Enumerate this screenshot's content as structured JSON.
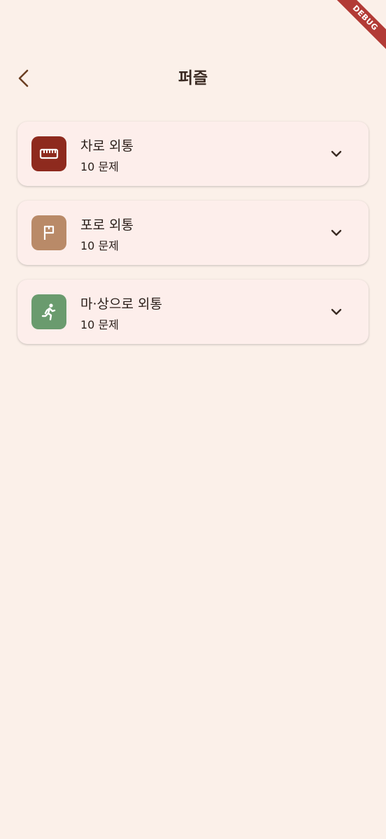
{
  "debug_banner": {
    "label": "DEBUG",
    "color": "#B23B36"
  },
  "app_bar": {
    "title": "퍼즐",
    "back_icon": "chevron-left-icon"
  },
  "categories": [
    {
      "title": "차로 외통",
      "count_label": "10 문제",
      "icon": "ruler-icon",
      "color": "#8E2A1E",
      "expanded": false
    },
    {
      "title": "포로 외통",
      "count_label": "10 문제",
      "icon": "flag-icon",
      "color": "#B98A68",
      "expanded": false
    },
    {
      "title": "마·상으로 외통",
      "count_label": "10 문제",
      "icon": "running-person-icon",
      "color": "#6A9B6E",
      "expanded": false
    }
  ],
  "colors": {
    "background": "#FBF0E9",
    "card": "#FDEEEB",
    "accent_brown": "#6B3F22"
  }
}
